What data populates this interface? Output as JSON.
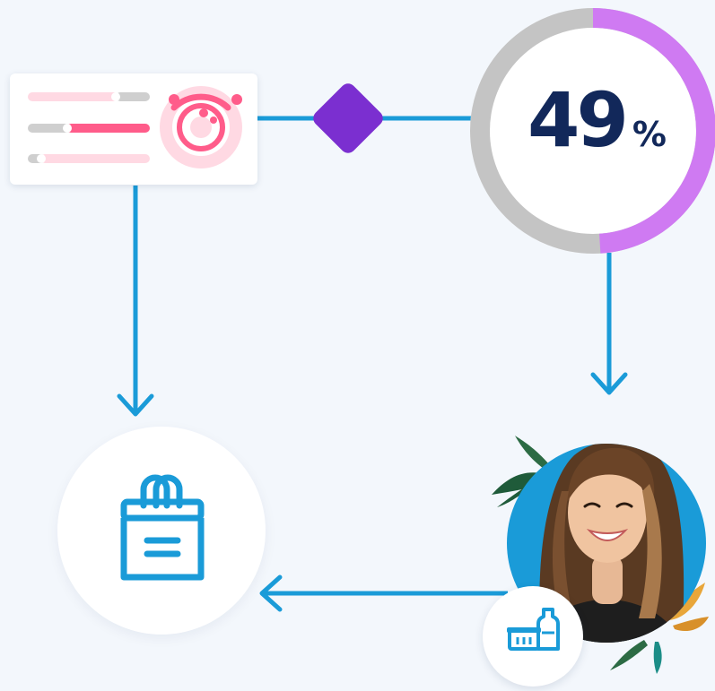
{
  "stat": {
    "value": "49",
    "unit": "%",
    "progress": 0.49
  },
  "colors": {
    "background": "#f3f7fc",
    "connector": "#1a9bd8",
    "diamond": "#7b2fd0",
    "ring_track": "#c4c4c4",
    "ring_progress": "#cf7af2",
    "stat_text": "#12285a",
    "slider_track": "#ffd9e3",
    "slider_active": "#ff5c8a",
    "slider_gray": "#cfcfcf",
    "avatar_bg": "#1a9bd8",
    "icon": "#1a9bd8"
  },
  "icons": {
    "settings_card": "sliders-and-target-icon",
    "decision": "diamond-icon",
    "shopping": "shopping-bag-icon",
    "customer": "customer-avatar",
    "grocery": "grocery-basket-bottle-icon",
    "decoration": "palm-leaves"
  }
}
